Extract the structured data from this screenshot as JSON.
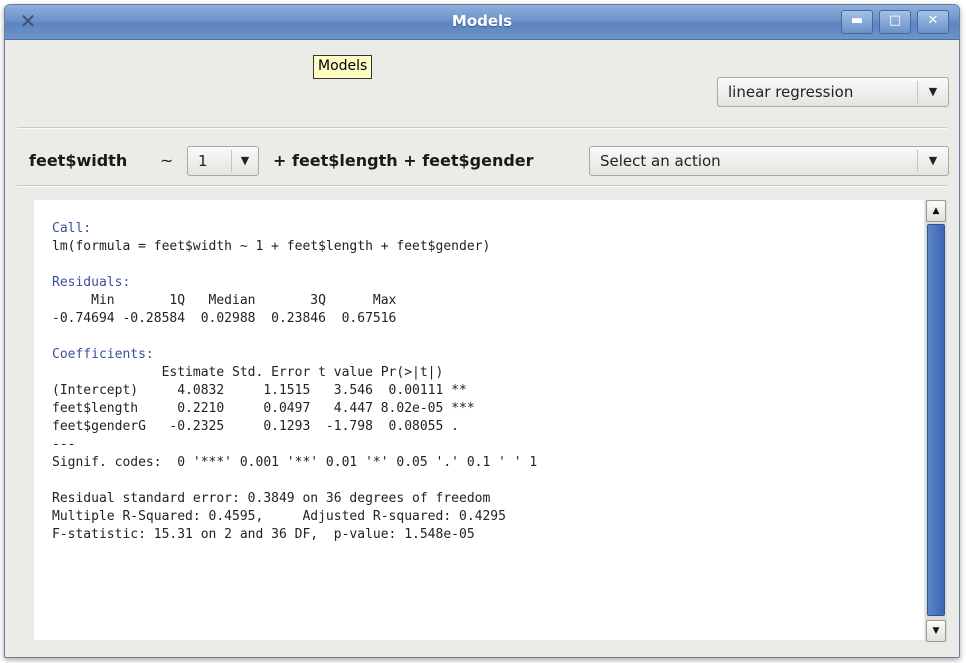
{
  "window": {
    "title": "Models",
    "controls": {
      "minimize": "▬",
      "maximize": "□",
      "close": "✕"
    }
  },
  "tooltip": "Models",
  "model_type": {
    "selected": "linear regression"
  },
  "formula": {
    "response": "feet$width",
    "tilde": "~",
    "intercept_value": "1",
    "terms": "+ feet$length + feet$gender",
    "action_placeholder": "Select an action"
  },
  "output": {
    "call_label": "Call:",
    "call_line": "lm(formula = feet$width ~ 1 + feet$length + feet$gender)",
    "residuals_label": "Residuals:",
    "residuals_header": "     Min       1Q   Median       3Q      Max",
    "residuals_values": "-0.74694 -0.28584  0.02988  0.23846  0.67516",
    "coefficients_label": "Coefficients:",
    "coef_header": "              Estimate Std. Error t value Pr(>|t|)",
    "coef_row_intercept": "(Intercept)     4.0832     1.1515   3.546  0.00111 **",
    "coef_row_length": "feet$length     0.2210     0.0497   4.447 8.02e-05 ***",
    "coef_row_gender": "feet$genderG   -0.2325     0.1293  -1.798  0.08055 .",
    "dashes": "---",
    "signif": "Signif. codes:  0 '***' 0.001 '**' 0.01 '*' 0.05 '.' 0.1 ' ' 1",
    "resid_se": "Residual standard error: 0.3849 on 36 degrees of freedom",
    "r_squared": "Multiple R-Squared: 0.4595,     Adjusted R-squared: 0.4295",
    "f_stat": "F-statistic: 15.31 on 2 and 36 DF,  p-value: 1.548e-05"
  },
  "scroll": {
    "up": "▲",
    "down": "▼"
  },
  "icons": {
    "dropdown": "▼",
    "app": "✕"
  },
  "colors": {
    "titlebar": "#6d92c8",
    "label": "#3c4f9a",
    "scroll_thumb": "#4a73bd"
  }
}
